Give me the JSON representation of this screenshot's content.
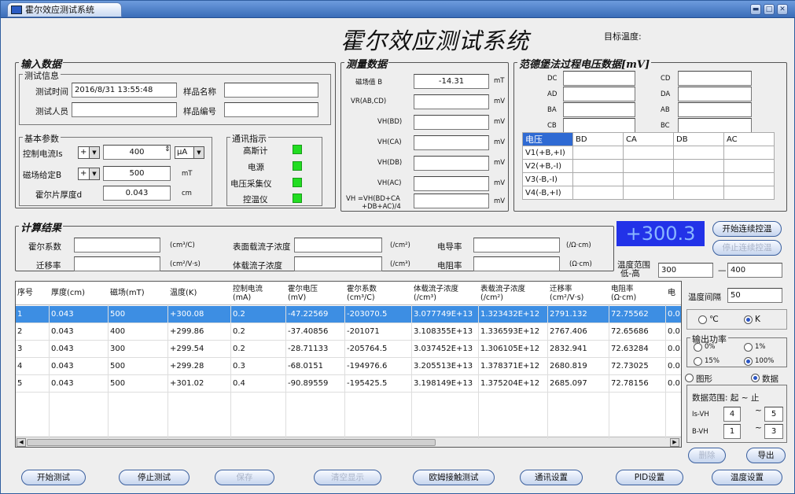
{
  "window": {
    "tab_title": "霍尔效应测试系统",
    "main_title": "霍尔效应测试系统",
    "target_temp_label": "目标温度:",
    "min_icon": "minimize-icon",
    "max_icon": "maximize-icon",
    "close_icon": "close-icon"
  },
  "input": {
    "title": "输入数据",
    "test_info_title": "测试信息",
    "test_time_label": "测试时间",
    "test_time_value": "2016/8/31 13:55:48",
    "sample_name_label": "样品名称",
    "sample_name_value": "",
    "tester_label": "测试人员",
    "tester_value": "",
    "sample_no_label": "样品编号",
    "sample_no_value": "",
    "basic_title": "基本参数",
    "current_label": "控制电流Is",
    "current_sign": "+",
    "current_value": "400",
    "current_unit": "μA",
    "field_label": "磁场给定B",
    "field_sign": "+",
    "field_value": "500",
    "field_unit": "mT",
    "thickness_label": "霍尔片厚度d",
    "thickness_value": "0.043",
    "thickness_unit": "cm",
    "comm_title": "通讯指示",
    "comm_items": [
      {
        "label": "高斯计"
      },
      {
        "label": "电源"
      },
      {
        "label": "电压采集仪"
      },
      {
        "label": "控温仪"
      }
    ]
  },
  "measure": {
    "title": "测量数据",
    "rows": [
      {
        "label": "磁场值 B",
        "value": "-14.31",
        "unit": "mT"
      },
      {
        "label": "VR(AB,CD)",
        "value": "",
        "unit": "mV"
      },
      {
        "label": "VH(BD)",
        "value": "",
        "unit": "mV"
      },
      {
        "label": "VH(CA)",
        "value": "",
        "unit": "mV"
      },
      {
        "label": "VH(DB)",
        "value": "",
        "unit": "mV"
      },
      {
        "label": "VH(AC)",
        "value": "",
        "unit": "mV"
      }
    ],
    "vh_label": "VH =VH(BD+CA",
    "vh_label2": "+DB+AC)/4",
    "vh_value": "",
    "vh_unit": "mV"
  },
  "vdp": {
    "title": "范德堡法过程电压数据[mV]",
    "left": [
      "DC",
      "AD",
      "BA",
      "CB"
    ],
    "right": [
      "CD",
      "DA",
      "AB",
      "BC"
    ],
    "table_head": [
      "电压",
      "BD",
      "CA",
      "DB",
      "AC"
    ],
    "table_rows": [
      "V1(+B,+I)",
      "V2(+B,-I)",
      "V3(-B,-I)",
      "V4(-B,+I)"
    ]
  },
  "calc": {
    "title": "计算结果",
    "hall_coef_label": "霍尔系数",
    "hall_coef_unit": "(cm³/C)",
    "surface_conc_label": "表面载流子浓度",
    "surface_conc_unit": "(/cm²)",
    "conductivity_label": "电导率",
    "conductivity_unit": "(/Ω·cm)",
    "mobility_label": "迁移率",
    "mobility_unit": "(cm²/V·s)",
    "bulk_conc_label": "体载流子浓度",
    "bulk_conc_unit": "(/cm³)",
    "resistivity_label": "电阻率",
    "resistivity_unit": "(Ω·cm)"
  },
  "readout": "+300.3",
  "controls": {
    "start_continuous": "开始连续控温",
    "stop_continuous": "停止连续控温",
    "temp_range_label": "温度范围",
    "temp_range_sub": "低-高",
    "temp_low": "300",
    "temp_high": "400",
    "dash": "—",
    "temp_interval_label": "温度间隔",
    "temp_interval_value": "50",
    "unit_c": "℃",
    "unit_k": "K",
    "unit_selected": "K",
    "power_title": "输出功率",
    "power_options": [
      "0%",
      "1%",
      "15%",
      "100%"
    ],
    "power_selected": "100%",
    "view_graph": "图形",
    "view_data": "数据",
    "view_selected": "数据",
    "range_title": "数据范围: 起 ~ 止",
    "is_vh_label": "Is-VH",
    "is_vh_start": "4",
    "is_vh_end": "5",
    "b_vh_label": "B-VH",
    "b_vh_start": "1",
    "b_vh_end": "3",
    "tilde": "~",
    "delete_label": "删除",
    "export_label": "导出"
  },
  "table": {
    "headers": [
      "序号",
      "厚度(cm)",
      "磁场(mT)",
      "温度(K)",
      "控制电流\n(mA)",
      "霍尔电压\n(mV)",
      "霍尔系数\n(cm³/C)",
      "体载流子浓度\n(/cm³)",
      "表载流子浓度\n(/cm²)",
      "迁移率\n(cm²/V·s)",
      "电阻率\n(Ω·cm)",
      "电"
    ],
    "rows": [
      [
        "1",
        "0.043",
        "500",
        "+300.08",
        "0.2",
        "-47.22569",
        "-203070.5",
        "3.077749E+13",
        "1.323432E+12",
        "2791.132",
        "72.75562",
        "0.0"
      ],
      [
        "2",
        "0.043",
        "400",
        "+299.86",
        "0.2",
        "-37.40856",
        "-201071",
        "3.108355E+13",
        "1.336593E+12",
        "2767.406",
        "72.65686",
        "0.0"
      ],
      [
        "3",
        "0.043",
        "300",
        "+299.54",
        "0.2",
        "-28.71133",
        "-205764.5",
        "3.037452E+13",
        "1.306105E+12",
        "2832.941",
        "72.63284",
        "0.0"
      ],
      [
        "4",
        "0.043",
        "500",
        "+299.28",
        "0.3",
        "-68.0151",
        "-194976.6",
        "3.205513E+13",
        "1.378371E+12",
        "2680.819",
        "72.73025",
        "0.0"
      ],
      [
        "5",
        "0.043",
        "500",
        "+301.02",
        "0.4",
        "-90.89559",
        "-195425.5",
        "3.198149E+13",
        "1.375204E+12",
        "2685.097",
        "72.78156",
        "0.0"
      ]
    ],
    "selected_row": 0
  },
  "bottom": [
    {
      "label": "开始测试",
      "enabled": true
    },
    {
      "label": "停止测试",
      "enabled": true
    },
    {
      "label": "保存",
      "enabled": false
    },
    {
      "label": "清空显示",
      "enabled": false
    },
    {
      "label": "欧姆接触测试",
      "enabled": true
    },
    {
      "label": "通讯设置",
      "enabled": true
    },
    {
      "label": "PID设置",
      "enabled": true
    },
    {
      "label": "温度设置",
      "enabled": true
    }
  ]
}
